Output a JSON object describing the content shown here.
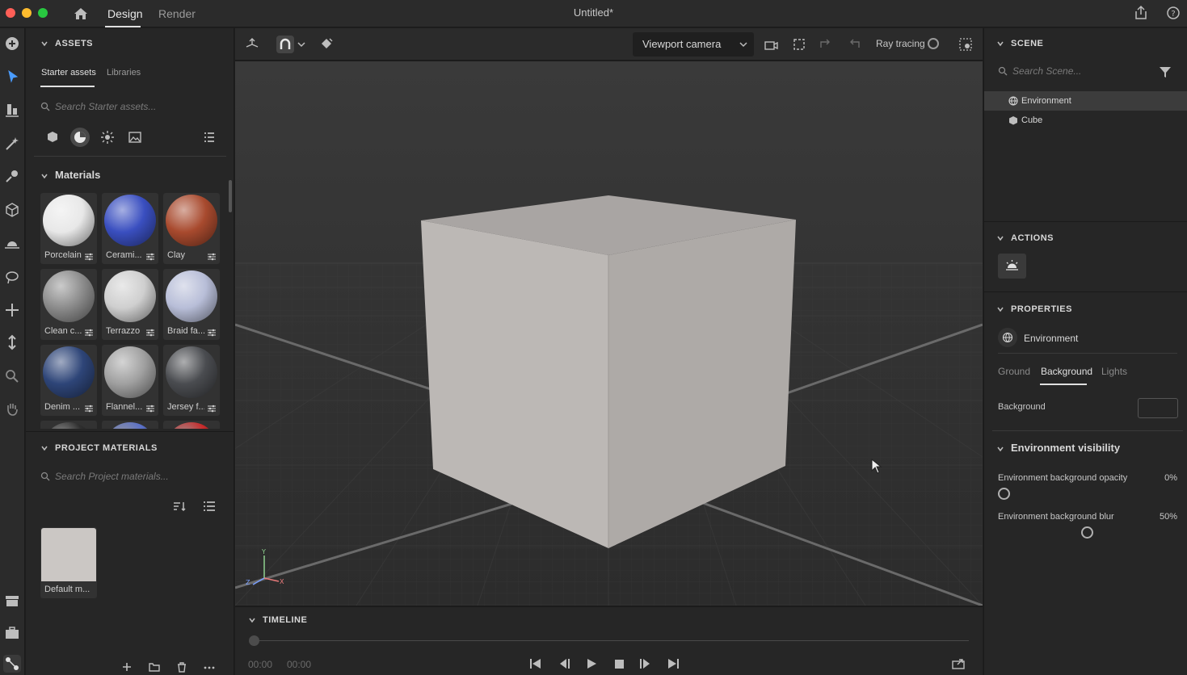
{
  "topbar": {
    "tabs": [
      "Design",
      "Render"
    ],
    "title": "Untitled*"
  },
  "assets": {
    "header": "ASSETS",
    "tabs": [
      "Starter assets",
      "Libraries"
    ],
    "search_placeholder": "Search Starter assets...",
    "materials_header": "Materials",
    "materials": [
      {
        "label": "Porcelain",
        "color": "#e8e8e8"
      },
      {
        "label": "Cerami...",
        "color": "#3a4fc0"
      },
      {
        "label": "Clay",
        "color": "#a84a2e"
      },
      {
        "label": "Clean c...",
        "color": "#8c8c8c"
      },
      {
        "label": "Terrazzo",
        "color": "#cfcfcf"
      },
      {
        "label": "Braid fa...",
        "color": "#b8bed8"
      },
      {
        "label": "Denim ...",
        "color": "#2e4578"
      },
      {
        "label": "Flannel...",
        "color": "#a0a0a0"
      },
      {
        "label": "Jersey f...",
        "color": "#4a4c50"
      }
    ]
  },
  "project_materials": {
    "header": "PROJECT MATERIALS",
    "search_placeholder": "Search Project materials...",
    "items": [
      {
        "label": "Default m..."
      }
    ]
  },
  "viewport": {
    "camera": "Viewport camera",
    "ray_tracing_label": "Ray tracing"
  },
  "timeline": {
    "header": "TIMELINE",
    "current_time": "00:00",
    "total_time": "00:00"
  },
  "scene": {
    "header": "SCENE",
    "search_placeholder": "Search Scene...",
    "items": [
      "Environment",
      "Cube"
    ]
  },
  "actions": {
    "header": "ACTIONS"
  },
  "properties": {
    "header": "PROPERTIES",
    "object": "Environment",
    "tabs": [
      "Ground",
      "Background",
      "Lights"
    ],
    "background_label": "Background",
    "visibility_header": "Environment visibility",
    "opacity_label": "Environment background opacity",
    "opacity_value": "0%",
    "blur_label": "Environment background blur",
    "blur_value": "50%"
  }
}
